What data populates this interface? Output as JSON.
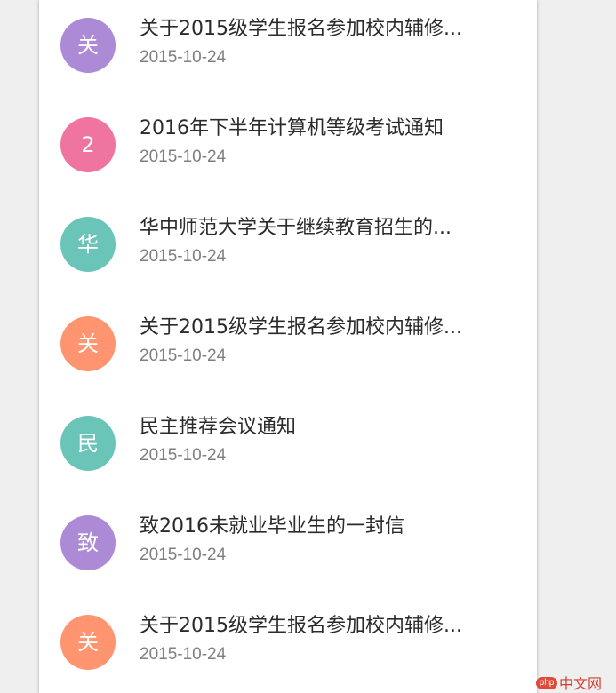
{
  "colors": {
    "purple": "#ad8ad6",
    "pink": "#ef749f",
    "teal": "#6ac4b7",
    "orange": "#ff9570"
  },
  "notices": [
    {
      "avatar": "关",
      "color": "#ad8ad6",
      "title": "关于2015级学生报名参加校内辅修...",
      "date": "2015-10-24"
    },
    {
      "avatar": "2",
      "color": "#ef749f",
      "title": "2016年下半年计算机等级考试通知",
      "date": "2015-10-24"
    },
    {
      "avatar": "华",
      "color": "#6ac4b7",
      "title": "华中师范大学关于继续教育招生的...",
      "date": "2015-10-24"
    },
    {
      "avatar": "关",
      "color": "#ff9570",
      "title": "关于2015级学生报名参加校内辅修...",
      "date": "2015-10-24"
    },
    {
      "avatar": "民",
      "color": "#6ac4b7",
      "title": "民主推荐会议通知",
      "date": "2015-10-24"
    },
    {
      "avatar": "致",
      "color": "#ad8ad6",
      "title": "致2016未就业毕业生的一封信",
      "date": "2015-10-24"
    },
    {
      "avatar": "关",
      "color": "#ff9570",
      "title": "关于2015级学生报名参加校内辅修...",
      "date": "2015-10-24"
    }
  ],
  "watermark": {
    "badge": "php",
    "text": "中文网"
  }
}
